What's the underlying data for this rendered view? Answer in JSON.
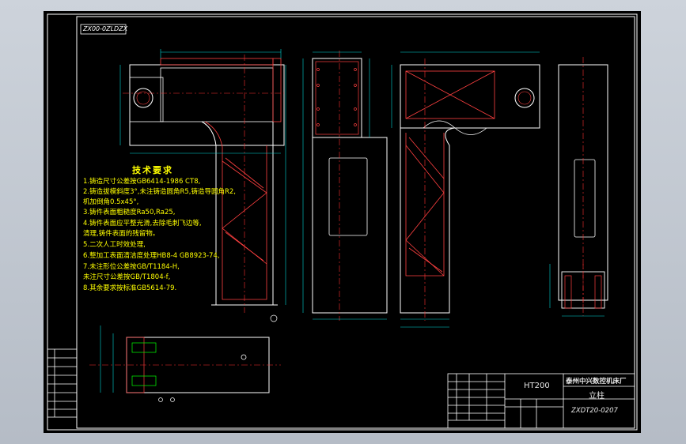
{
  "drawing": {
    "code_stamp": "ZX00-0ZLDZX",
    "material": "HT200",
    "company": "泰州中兴数控机床厂",
    "part_name": "立柱",
    "drawing_number": "ZXDT20-0207"
  },
  "technical_requirements": {
    "title": "技术要求",
    "items": [
      "1.铸造尺寸公差按GB6414-1986 CT8,",
      "2.铸造拔模斜度3°,未注铸造圆角R5,铸造导圆角R2,",
      "   机加倒角0.5x45°,",
      "3.铸件表面粗糙度Ra50,Ra25,",
      "4.铸件表面应平整光滑,去除毛刺飞边等,",
      "   清理,铸件表面的残留物。",
      "5.二次人工时效处理,",
      "6.整加工表面清洁度处理HB8-4 GB8923-74,",
      "7.未注形位公差按GB/T1184-H,",
      "   未注尺寸公差按GB/T1804-f,",
      "8.其余要求按标准GB5614-79."
    ]
  },
  "colors": {
    "background": "#000000",
    "outline": "#ffffff",
    "centerline": "#ff3030",
    "hatch": "#ff4040",
    "dimension": "#00d7d7",
    "dimension_alt": "#00ff00",
    "text": "#ffff00",
    "border": "#ffffff"
  }
}
